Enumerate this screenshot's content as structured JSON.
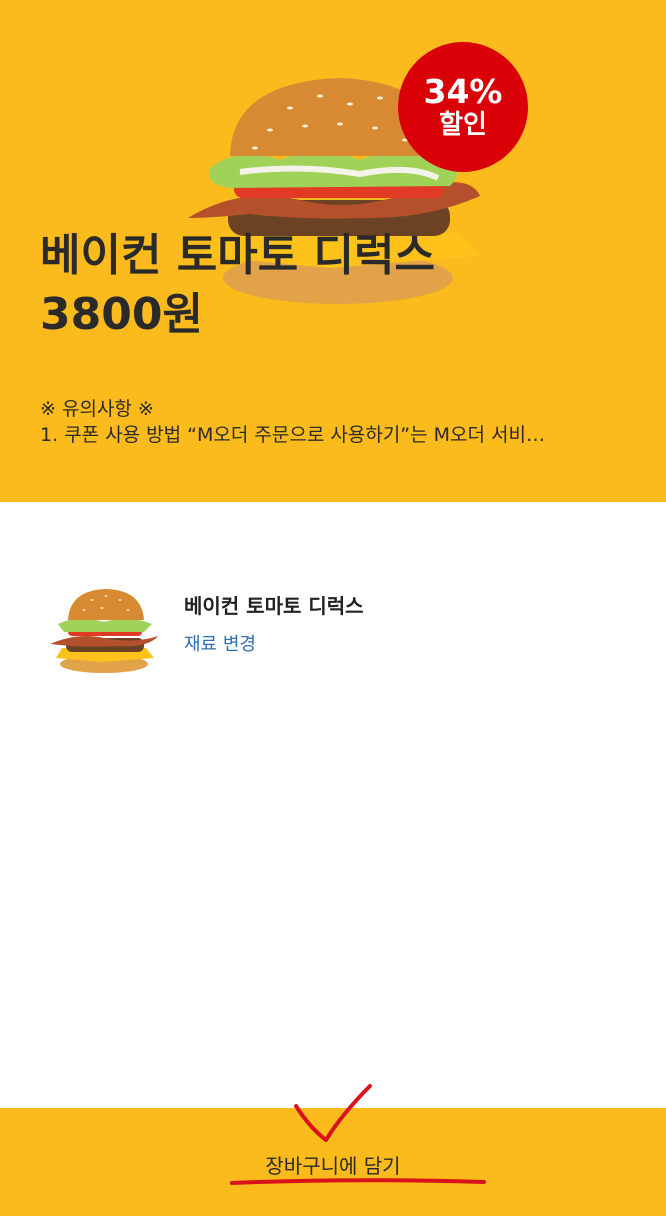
{
  "product": {
    "title_line1": "베이컨 토마토 디럭스",
    "title_line2": "3800원",
    "discount_percent": "34%",
    "discount_label": "할인"
  },
  "notice": {
    "heading": "※ 유의사항 ※",
    "body": "1. 쿠폰 사용 방법 “M오더 주문으로 사용하기”는 M오더 서비…"
  },
  "item": {
    "name": "베이컨 토마토 디럭스",
    "change_label": "재료 변경"
  },
  "footer": {
    "cart_label": "장바구니에 담기"
  },
  "colors": {
    "brand_yellow": "#fbbb1d",
    "badge_red": "#d90007",
    "link_blue": "#2f6fb3",
    "annotation_red": "#d8131b"
  }
}
